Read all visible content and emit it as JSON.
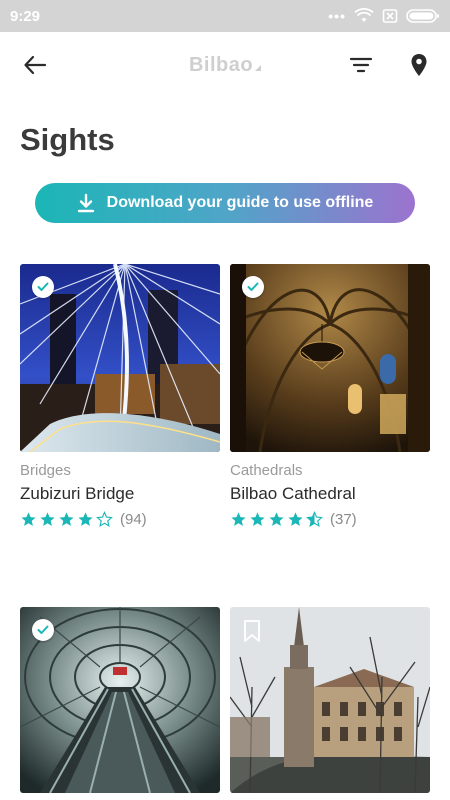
{
  "status_bar": {
    "time": "9:29",
    "dots": "•••"
  },
  "header": {
    "brand": "Bilbao"
  },
  "page": {
    "title": "Sights"
  },
  "download": {
    "label": "Download your guide to use offline"
  },
  "cards": [
    {
      "category": "Bridges",
      "title": "Zubizuri Bridge",
      "rating": 4,
      "count": "(94)",
      "saved": true
    },
    {
      "category": "Cathedrals",
      "title": "Bilbao Cathedral",
      "rating": 4.5,
      "count": "(37)",
      "saved": true
    },
    {
      "category": "",
      "title": "",
      "rating": null,
      "count": "",
      "saved": true
    },
    {
      "category": "",
      "title": "",
      "rating": null,
      "count": "",
      "saved": false
    }
  ],
  "colors": {
    "accent": "#1bb6b6",
    "gradient_end": "#9c73cf",
    "status_bar": "#d4d4d4"
  }
}
